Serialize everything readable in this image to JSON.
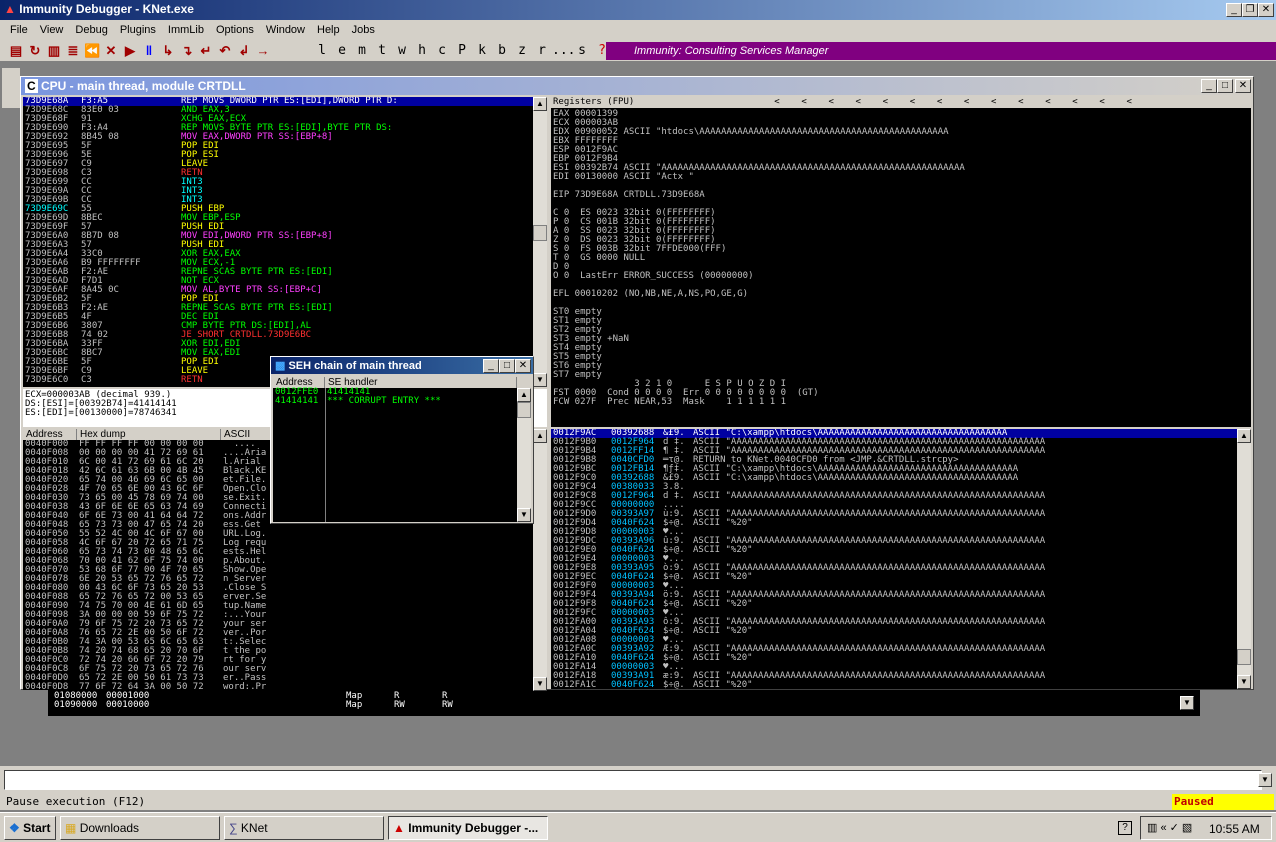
{
  "app": {
    "title": "Immunity Debugger - KNet.exe",
    "cpu_title": "CPU - main thread, module CRTDLL",
    "banner": "Immunity: Consulting Services Manager"
  },
  "menu": [
    "File",
    "View",
    "Debug",
    "Plugins",
    "ImmLib",
    "Options",
    "Window",
    "Help",
    "Jobs"
  ],
  "toolbar_letters": [
    "l",
    "e",
    "m",
    "t",
    "w",
    "h",
    "c",
    "P",
    "k",
    "b",
    "z",
    "r",
    "...",
    "s",
    "?"
  ],
  "disasm": [
    [
      "73D9E68A",
      "F3:A5",
      "REP MOVS DWORD PTR ES:[EDI],DWORD PTR D:",
      "sel"
    ],
    [
      "73D9E68C",
      "83E0 03",
      "AND EAX,3",
      "g"
    ],
    [
      "73D9E68F",
      "91",
      "XCHG EAX,ECX",
      "g"
    ],
    [
      "73D9E690",
      "F3:A4",
      "REP MOVS BYTE PTR ES:[EDI],BYTE PTR DS:",
      "g"
    ],
    [
      "73D9E692",
      "8B45 08",
      "MOV EAX,DWORD PTR SS:[EBP+8]",
      "m"
    ],
    [
      "73D9E695",
      "5F",
      "POP EDI",
      "y"
    ],
    [
      "73D9E696",
      "5E",
      "POP ESI",
      "y"
    ],
    [
      "73D9E697",
      "C9",
      "LEAVE",
      "y"
    ],
    [
      "73D9E698",
      "C3",
      "RETN",
      "r"
    ],
    [
      "73D9E699",
      "CC",
      "INT3",
      "c"
    ],
    [
      "73D9E69A",
      "CC",
      "INT3",
      "c"
    ],
    [
      "73D9E69B",
      "CC",
      "INT3",
      "c"
    ],
    [
      "73D9E69C",
      "55",
      "PUSH EBP",
      "y"
    ],
    [
      "73D9E69D",
      "8BEC",
      "MOV EBP,ESP",
      "g"
    ],
    [
      "73D9E69F",
      "57",
      "PUSH EDI",
      "y"
    ],
    [
      "73D9E6A0",
      "8B7D 08",
      "MOV EDI,DWORD PTR SS:[EBP+8]",
      "m"
    ],
    [
      "73D9E6A3",
      "57",
      "PUSH EDI",
      "y"
    ],
    [
      "73D9E6A4",
      "33C0",
      "XOR EAX,EAX",
      "g"
    ],
    [
      "73D9E6A6",
      "B9 FFFFFFFF",
      "MOV ECX,-1",
      "g"
    ],
    [
      "73D9E6AB",
      "F2:AE",
      "REPNE SCAS BYTE PTR ES:[EDI]",
      "g"
    ],
    [
      "73D9E6AD",
      "F7D1",
      "NOT ECX",
      "g"
    ],
    [
      "73D9E6AF",
      "8A45 0C",
      "MOV AL,BYTE PTR SS:[EBP+C]",
      "m"
    ],
    [
      "73D9E6B2",
      "5F",
      "POP EDI",
      "y"
    ],
    [
      "73D9E6B3",
      "F2:AE",
      "REPNE SCAS BYTE PTR ES:[EDI]",
      "g"
    ],
    [
      "73D9E6B5",
      "4F",
      "DEC EDI",
      "g"
    ],
    [
      "73D9E6B6",
      "3807",
      "CMP BYTE PTR DS:[EDI],AL",
      "g"
    ],
    [
      "73D9E6B8",
      "74 02",
      "JE SHORT CRTDLL.73D9E6BC",
      "r"
    ],
    [
      "73D9E6BA",
      "33FF",
      "XOR EDI,EDI",
      "g"
    ],
    [
      "73D9E6BC",
      "8BC7",
      "MOV EAX,EDI",
      "g"
    ],
    [
      "73D9E6BE",
      "5F",
      "POP EDI",
      "y"
    ],
    [
      "73D9E6BF",
      "C9",
      "LEAVE",
      "y"
    ],
    [
      "73D9E6C0",
      "C3",
      "RETN",
      "r"
    ]
  ],
  "info": [
    "ECX=000003AB (decimal 939.)",
    "DS:[ESI]=[00392B74]=41414141",
    "ES:[EDI]=[00130000]=78746341"
  ],
  "registers_header": "Registers (FPU)",
  "registers": [
    "EAX 00001399",
    "ECX 000003AB",
    "EDX 00900052 ASCII \"htdocs\\AAAAAAAAAAAAAAAAAAAAAAAAAAAAAAAAAAAAAAAAAAAAAA",
    "EBX FFFFFFFF",
    "ESP 0012F9AC",
    "EBP 0012F9B4",
    "ESI 00392B74 ASCII \"AAAAAAAAAAAAAAAAAAAAAAAAAAAAAAAAAAAAAAAAAAAAAAAAAAAAAAAA",
    "EDI 00130000 ASCII \"Actx \"",
    "",
    "EIP 73D9E68A CRTDLL.73D9E68A",
    "",
    "C 0  ES 0023 32bit 0(FFFFFFFF)",
    "P 0  CS 001B 32bit 0(FFFFFFFF)",
    "A 0  SS 0023 32bit 0(FFFFFFFF)",
    "Z 0  DS 0023 32bit 0(FFFFFFFF)",
    "S 0  FS 003B 32bit 7FFDE000(FFF)",
    "T 0  GS 0000 NULL",
    "D 0",
    "O 0  LastErr ERROR_SUCCESS (00000000)",
    "",
    "EFL 00010202 (NO,NB,NE,A,NS,PO,GE,G)",
    "",
    "ST0 empty",
    "ST1 empty",
    "ST2 empty",
    "ST3 empty +NaN",
    "ST4 empty",
    "ST5 empty",
    "ST6 empty",
    "ST7 empty",
    "               3 2 1 0      E S P U O Z D I",
    "FST 0000  Cond 0 0 0 0  Err 0 0 0 0 0 0 0 0  (GT)",
    "FCW 027F  Prec NEAR,53  Mask    1 1 1 1 1 1"
  ],
  "dump_headers": [
    "Address",
    "Hex dump",
    "ASCII"
  ],
  "dump": [
    [
      "0040F000",
      "FF FF FF FF 00 00 00 00",
      "  ...."
    ],
    [
      "0040F008",
      "00 00 00 00 41 72 69 61",
      "....Aria"
    ],
    [
      "0040F010",
      "6C 00 41 72 69 61 6C 20",
      "l.Arial "
    ],
    [
      "0040F018",
      "42 6C 61 63 6B 00 4B 45",
      "Black.KE"
    ],
    [
      "0040F020",
      "65 74 00 46 69 6C 65 00",
      "et.File."
    ],
    [
      "0040F028",
      "4F 70 65 6E 00 43 6C 6F",
      "Open.Clo"
    ],
    [
      "0040F030",
      "73 65 00 45 78 69 74 00",
      "se.Exit."
    ],
    [
      "0040F038",
      "43 6F 6E 6E 65 63 74 69",
      "Connecti"
    ],
    [
      "0040F040",
      "6F 6E 73 00 41 64 64 72",
      "ons.Addr"
    ],
    [
      "0040F048",
      "65 73 73 00 47 65 74 20",
      "ess.Get "
    ],
    [
      "0040F050",
      "55 52 4C 00 4C 6F 67 00",
      "URL.Log."
    ],
    [
      "0040F058",
      "4C 6F 67 20 72 65 71 75",
      "Log requ"
    ],
    [
      "0040F060",
      "65 73 74 73 00 48 65 6C",
      "ests.Hel"
    ],
    [
      "0040F068",
      "70 00 41 62 6F 75 74 00",
      "p.About."
    ],
    [
      "0040F070",
      "53 68 6F 77 00 4F 70 65",
      "Show.Ope"
    ],
    [
      "0040F078",
      "6E 20 53 65 72 76 65 72",
      "n Server"
    ],
    [
      "0040F080",
      "00 43 6C 6F 73 65 20 53",
      ".Close S"
    ],
    [
      "0040F088",
      "65 72 76 65 72 00 53 65",
      "erver.Se"
    ],
    [
      "0040F090",
      "74 75 70 00 4E 61 6D 65",
      "tup.Name"
    ],
    [
      "0040F098",
      "3A 00 00 00 59 6F 75 72",
      ":...Your"
    ],
    [
      "0040F0A0",
      "79 6F 75 72 20 73 65 72",
      "your ser"
    ],
    [
      "0040F0A8",
      "76 65 72 2E 00 50 6F 72",
      "ver..Por"
    ],
    [
      "0040F0B0",
      "74 3A 00 53 65 6C 65 63",
      "t:.Selec"
    ],
    [
      "0040F0B8",
      "74 20 74 68 65 20 70 6F",
      "t the po"
    ],
    [
      "0040F0C0",
      "72 74 20 66 6F 72 20 79",
      "rt for y"
    ],
    [
      "0040F0C8",
      "6F 75 72 20 73 65 72 76",
      "our serv"
    ],
    [
      "0040F0D0",
      "65 72 2E 00 50 61 73 73",
      "er..Pass"
    ],
    [
      "0040F0D8",
      "77 6F 72 64 3A 00 50 72",
      "word:.Pr"
    ]
  ],
  "stack": [
    [
      "0012F9AC",
      "00392688",
      "&£9.",
      "ASCII \"C:\\xampp\\htdocs\\AAAAAAAAAAAAAAAAAAAAAAAAAAAAAAAAAAA",
      "sel"
    ],
    [
      "0012F9B0",
      "0012F964",
      "d ‡.",
      "ASCII \"AAAAAAAAAAAAAAAAAAAAAAAAAAAAAAAAAAAAAAAAAAAAAAAAAAAAAAAAAA",
      ""
    ],
    [
      "0012F9B4",
      "0012FF14",
      "¶ ‡.",
      "ASCII \"AAAAAAAAAAAAAAAAAAAAAAAAAAAAAAAAAAAAAAAAAAAAAAAAAAAAAAAAAA",
      ""
    ],
    [
      "0012F9B8",
      "0040CFD0",
      "═τ@.",
      "RETURN to KNet.0040CFD0 from <JMP.&CRTDLL.strcpy>",
      ""
    ],
    [
      "0012F9BC",
      "0012FB14",
      "¶ƒ‡.",
      "ASCII \"C:\\xampp\\htdocs\\AAAAAAAAAAAAAAAAAAAAAAAAAAAAAAAAAAAAA",
      ""
    ],
    [
      "0012F9C0",
      "00392688",
      "&£9.",
      "ASCII \"C:\\xampp\\htdocs\\AAAAAAAAAAAAAAAAAAAAAAAAAAAAAAAAAAAAA",
      ""
    ],
    [
      "0012F9C4",
      "00380033",
      "3.8.",
      "",
      ""
    ],
    [
      "0012F9C8",
      "0012F964",
      "d ‡.",
      "ASCII \"AAAAAAAAAAAAAAAAAAAAAAAAAAAAAAAAAAAAAAAAAAAAAAAAAAAAAAAAAA",
      ""
    ],
    [
      "0012F9CC",
      "00000000",
      "....",
      "",
      ""
    ],
    [
      "0012F9D0",
      "00393A97",
      "ù:9.",
      "ASCII \"AAAAAAAAAAAAAAAAAAAAAAAAAAAAAAAAAAAAAAAAAAAAAAAAAAAAAAAAAA",
      ""
    ],
    [
      "0012F9D4",
      "0040F624",
      "$÷@.",
      "ASCII \"%20\"",
      ""
    ],
    [
      "0012F9D8",
      "00000003",
      "♥...",
      "",
      ""
    ],
    [
      "0012F9DC",
      "00393A96",
      "û:9.",
      "ASCII \"AAAAAAAAAAAAAAAAAAAAAAAAAAAAAAAAAAAAAAAAAAAAAAAAAAAAAAAAAA",
      ""
    ],
    [
      "0012F9E0",
      "0040F624",
      "$÷@.",
      "ASCII \"%20\"",
      ""
    ],
    [
      "0012F9E4",
      "00000003",
      "♥...",
      "",
      ""
    ],
    [
      "0012F9E8",
      "00393A95",
      "ò:9.",
      "ASCII \"AAAAAAAAAAAAAAAAAAAAAAAAAAAAAAAAAAAAAAAAAAAAAAAAAAAAAAAAAA",
      ""
    ],
    [
      "0012F9EC",
      "0040F624",
      "$÷@.",
      "ASCII \"%20\"",
      ""
    ],
    [
      "0012F9F0",
      "00000003",
      "♥...",
      "",
      ""
    ],
    [
      "0012F9F4",
      "00393A94",
      "ö:9.",
      "ASCII \"AAAAAAAAAAAAAAAAAAAAAAAAAAAAAAAAAAAAAAAAAAAAAAAAAAAAAAAAAA",
      ""
    ],
    [
      "0012F9F8",
      "0040F624",
      "$÷@.",
      "ASCII \"%20\"",
      ""
    ],
    [
      "0012F9FC",
      "00000003",
      "♥...",
      "",
      ""
    ],
    [
      "0012FA00",
      "00393A93",
      "ô:9.",
      "ASCII \"AAAAAAAAAAAAAAAAAAAAAAAAAAAAAAAAAAAAAAAAAAAAAAAAAAAAAAAAAA",
      ""
    ],
    [
      "0012FA04",
      "0040F624",
      "$÷@.",
      "ASCII \"%20\"",
      ""
    ],
    [
      "0012FA08",
      "00000003",
      "♥...",
      "",
      ""
    ],
    [
      "0012FA0C",
      "00393A92",
      "Æ:9.",
      "ASCII \"AAAAAAAAAAAAAAAAAAAAAAAAAAAAAAAAAAAAAAAAAAAAAAAAAAAAAAAAAA",
      ""
    ],
    [
      "0012FA10",
      "0040F624",
      "$÷@.",
      "ASCII \"%20\"",
      ""
    ],
    [
      "0012FA14",
      "00000003",
      "♥...",
      "",
      ""
    ],
    [
      "0012FA18",
      "00393A91",
      "æ:9.",
      "ASCII \"AAAAAAAAAAAAAAAAAAAAAAAAAAAAAAAAAAAAAAAAAAAAAAAAAAAAAAAAAA",
      ""
    ],
    [
      "0012FA1C",
      "0040F624",
      "$÷@.",
      "ASCII \"%20\"",
      ""
    ]
  ],
  "seh": {
    "title": "SEH chain of main thread",
    "headers": [
      "Address",
      "SE handler"
    ],
    "rows": [
      [
        "0012FFE0",
        "41414141"
      ],
      [
        "41414141",
        "*** CORRUPT ENTRY ***"
      ]
    ]
  },
  "memmap": [
    [
      "01080000",
      "00001000",
      "",
      "Map",
      "R",
      "R"
    ],
    [
      "01090000",
      "00010000",
      "",
      "Map",
      "RW",
      "RW"
    ]
  ],
  "status": {
    "text": "Pause execution (F12)",
    "state": "Paused"
  },
  "taskbar": {
    "start": "Start",
    "items": [
      "Downloads",
      "KNet",
      "Immunity Debugger -..."
    ],
    "clock": "10:55 AM"
  },
  "colors": {
    "accent": "#800080",
    "paused_bg": "#ffff00",
    "paused_fg": "#c00000"
  }
}
